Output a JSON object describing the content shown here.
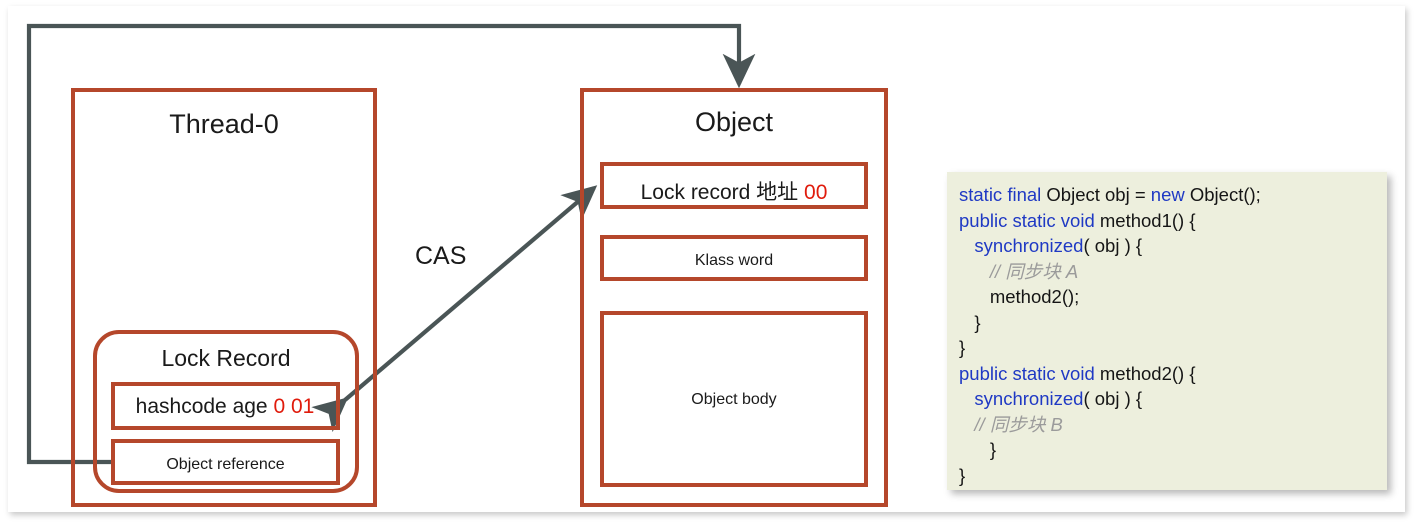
{
  "diagram": {
    "thread_box": {
      "title": "Thread-0"
    },
    "lock_record_group": {
      "title": "Lock Record",
      "rows": [
        {
          "prefix": "hashcode age ",
          "value": "0 01"
        },
        {
          "label": "Object reference"
        }
      ]
    },
    "object_box": {
      "title": "Object",
      "rows": [
        {
          "prefix": "Lock record 地址 ",
          "value": "00"
        },
        {
          "label": "Klass word"
        },
        {
          "label": "Object body"
        }
      ]
    },
    "cas_label": "CAS",
    "colors": {
      "box_border": "#B5472B",
      "connector": "#4A5556",
      "highlight_value": "#E01B0C",
      "code_background": "#EDEFDD",
      "code_keyword": "#1F39C4",
      "code_comment": "#9B9B9B"
    }
  },
  "code": {
    "lines": [
      [
        {
          "t": "static final ",
          "s": "kw"
        },
        {
          "t": "Object obj = ",
          "s": ""
        },
        {
          "t": "new ",
          "s": "kw"
        },
        {
          "t": "Object();",
          "s": ""
        }
      ],
      [
        {
          "t": "public static void ",
          "s": "kw"
        },
        {
          "t": "method1() {",
          "s": ""
        }
      ],
      [
        {
          "t": "   ",
          "s": ""
        },
        {
          "t": "synchronized",
          "s": "kw"
        },
        {
          "t": "( obj ) {",
          "s": ""
        }
      ],
      [
        {
          "t": "      ",
          "s": ""
        },
        {
          "t": "// 同步块 A",
          "s": "cm"
        }
      ],
      [
        {
          "t": "      method2();",
          "s": ""
        }
      ],
      [
        {
          "t": "   }",
          "s": ""
        }
      ],
      [
        {
          "t": "}",
          "s": ""
        }
      ],
      [
        {
          "t": "public static void ",
          "s": "kw"
        },
        {
          "t": "method2() {",
          "s": ""
        }
      ],
      [
        {
          "t": "   ",
          "s": ""
        },
        {
          "t": "synchronized",
          "s": "kw"
        },
        {
          "t": "( obj ) {",
          "s": ""
        }
      ],
      [
        {
          "t": "   ",
          "s": ""
        },
        {
          "t": "// 同步块 B",
          "s": "cm"
        }
      ],
      [
        {
          "t": "      }",
          "s": ""
        }
      ],
      [
        {
          "t": "}",
          "s": ""
        }
      ]
    ]
  }
}
